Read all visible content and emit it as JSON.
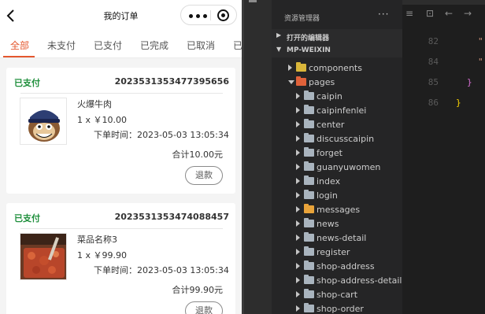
{
  "phone": {
    "title": "我的订单",
    "tabs": [
      "全部",
      "未支付",
      "已支付",
      "已完成",
      "已取消",
      "已"
    ],
    "orders": [
      {
        "status": "已支付",
        "order_no": "2023531353477395656",
        "name": "火爆牛肉",
        "qty_price": "1 x ￥10.00",
        "time": "下单时间：2023-05-03 13:05:34",
        "total": "合计10.00元",
        "refund": "退款"
      },
      {
        "status": "已支付",
        "order_no": "2023531353474088457",
        "name": "菜品名称3",
        "qty_price": "1 x ￥99.90",
        "time": "下单时间：2023-05-03 13:05:34",
        "total": "合计99.90元",
        "refund": "退款"
      }
    ]
  },
  "explorer": {
    "title": "资源管理器",
    "more": "···",
    "open_editors": "打开的编辑器",
    "project": "MP-WEIXIN",
    "tree": [
      {
        "label": "components",
        "level": 1,
        "expanded": false,
        "color": "yellow"
      },
      {
        "label": "pages",
        "level": 1,
        "expanded": true,
        "color": "red"
      },
      {
        "label": "caipin",
        "level": 2,
        "expanded": false,
        "color": "gray"
      },
      {
        "label": "caipinfenlei",
        "level": 2,
        "expanded": false,
        "color": "gray"
      },
      {
        "label": "center",
        "level": 2,
        "expanded": false,
        "color": "gray"
      },
      {
        "label": "discusscaipin",
        "level": 2,
        "expanded": false,
        "color": "gray"
      },
      {
        "label": "forget",
        "level": 2,
        "expanded": false,
        "color": "gray"
      },
      {
        "label": "guanyuwomen",
        "level": 2,
        "expanded": false,
        "color": "gray"
      },
      {
        "label": "index",
        "level": 2,
        "expanded": false,
        "color": "gray"
      },
      {
        "label": "login",
        "level": 2,
        "expanded": false,
        "color": "gray"
      },
      {
        "label": "messages",
        "level": 2,
        "expanded": false,
        "color": "orange"
      },
      {
        "label": "news",
        "level": 2,
        "expanded": false,
        "color": "gray"
      },
      {
        "label": "news-detail",
        "level": 2,
        "expanded": false,
        "color": "gray"
      },
      {
        "label": "register",
        "level": 2,
        "expanded": false,
        "color": "gray"
      },
      {
        "label": "shop-address",
        "level": 2,
        "expanded": false,
        "color": "gray"
      },
      {
        "label": "shop-address-detail",
        "level": 2,
        "expanded": false,
        "color": "gray"
      },
      {
        "label": "shop-cart",
        "level": 2,
        "expanded": false,
        "color": "gray"
      },
      {
        "label": "shop-order",
        "level": 2,
        "expanded": false,
        "color": "gray"
      }
    ]
  },
  "editor": {
    "line_numbers": [
      "82",
      "84",
      "85",
      "86"
    ],
    "code_tokens": [
      "\"",
      "\"",
      "}",
      "}"
    ]
  },
  "colors": {
    "accent": "#e4572e",
    "paid_status": "#1f8f3c"
  },
  "icons": [
    "back-arrow-icon",
    "more-dots-icon",
    "target-icon",
    "folder-icon",
    "chevron-icon"
  ]
}
